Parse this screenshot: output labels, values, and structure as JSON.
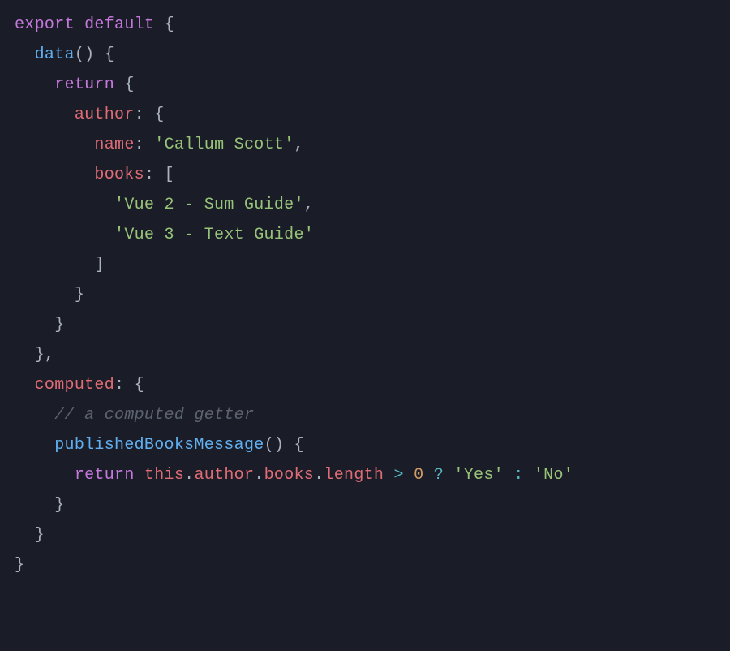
{
  "code": {
    "t_export": "export",
    "t_default": "default",
    "t_data": "data",
    "t_return1": "return",
    "t_author": "author",
    "t_name": "name",
    "t_name_val": "'Callum Scott'",
    "t_books": "books",
    "t_book1": "'Vue 2 - Sum Guide'",
    "t_book2": "'Vue 3 - Text Guide'",
    "t_computed": "computed",
    "t_comment": "// a computed getter",
    "t_pubMethod": "publishedBooksMessage",
    "t_return2": "return",
    "t_this": "this",
    "t_authorAccess": "author",
    "t_booksAccess": "books",
    "t_length": "length",
    "t_gt": ">",
    "t_zero": "0",
    "t_q": "?",
    "t_yes": "'Yes'",
    "t_colon": ":",
    "t_no": "'No'",
    "b_open": "{",
    "b_close": "}",
    "br_open": "[",
    "br_close": "]",
    "paren_open": "(",
    "paren_close": ")",
    "comma": ",",
    "colon_p": ":",
    "dot": "."
  }
}
